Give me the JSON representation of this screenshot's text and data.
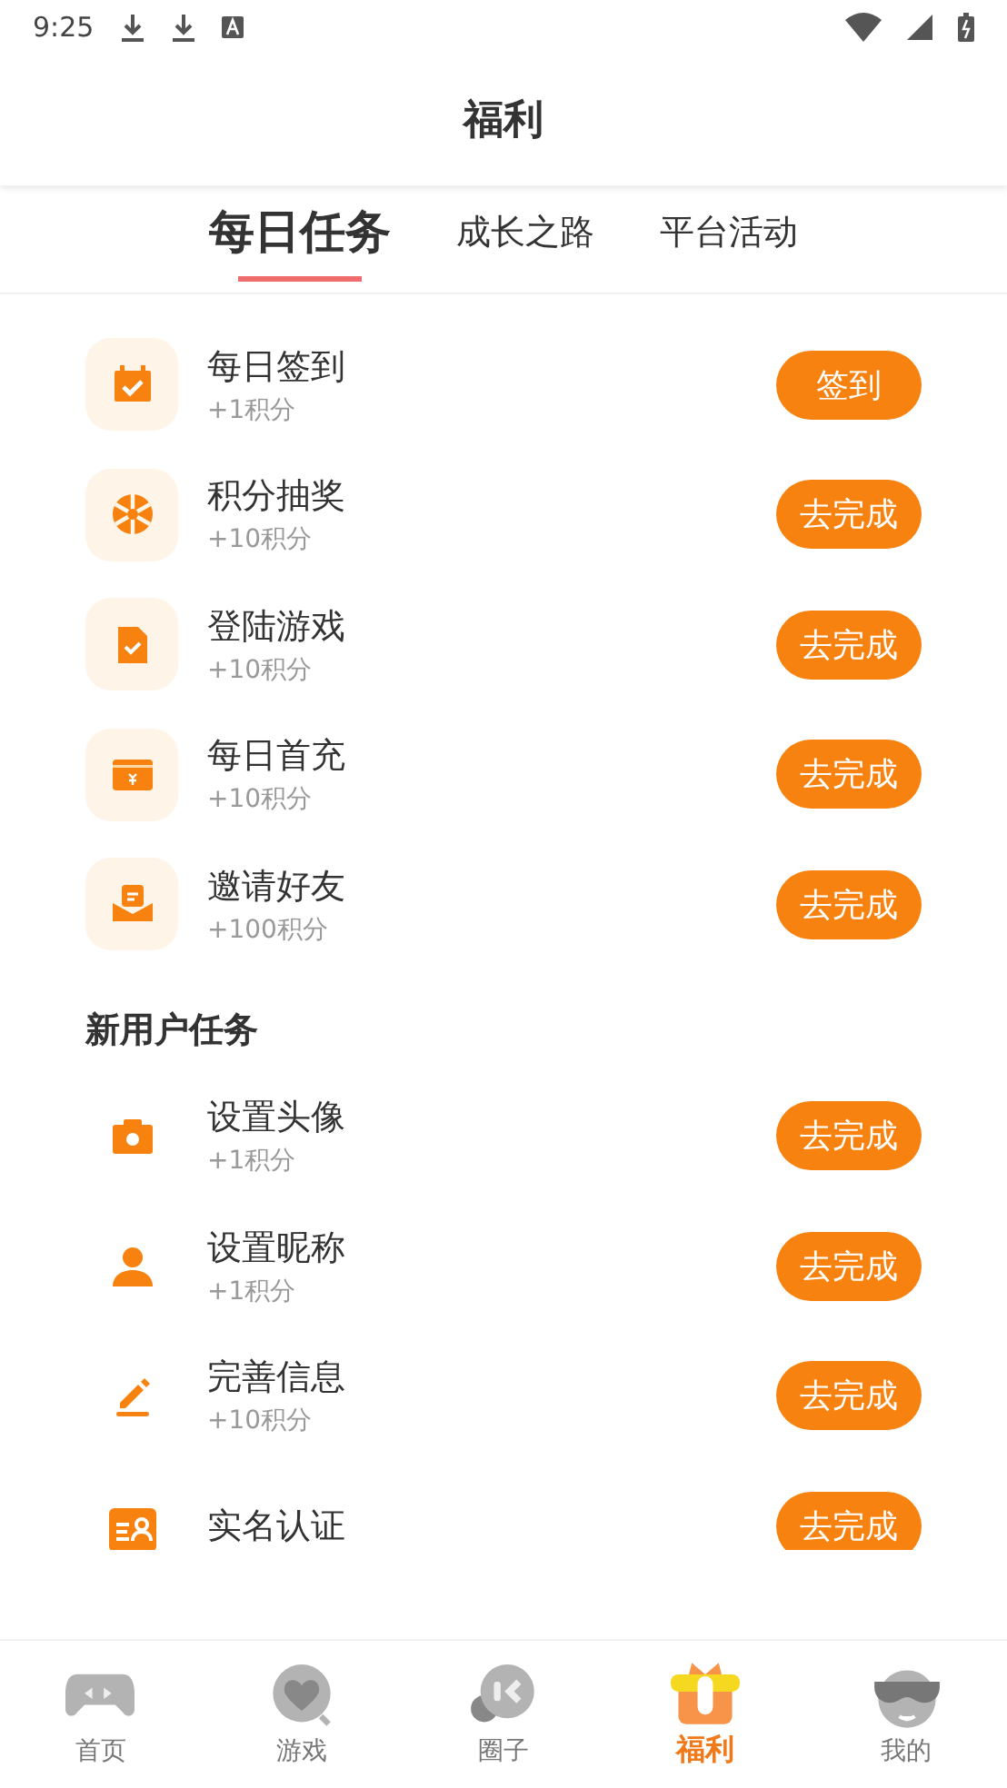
{
  "status_bar": {
    "time": "9:25"
  },
  "header": {
    "title": "福利"
  },
  "tabs": [
    {
      "label": "每日任务",
      "selected": true
    },
    {
      "label": "成长之路",
      "selected": false
    },
    {
      "label": "平台活动",
      "selected": false
    }
  ],
  "daily_tasks": [
    {
      "kind": "calendar",
      "title": "每日签到",
      "reward": "+1积分",
      "button": "签到"
    },
    {
      "kind": "wheel",
      "title": "积分抽奖",
      "reward": "+10积分",
      "button": "去完成"
    },
    {
      "kind": "document",
      "title": "登陆游戏",
      "reward": "+10积分",
      "button": "去完成"
    },
    {
      "kind": "wallet",
      "title": "每日首充",
      "reward": "+10积分",
      "button": "去完成"
    },
    {
      "kind": "envelope",
      "title": "邀请好友",
      "reward": "+100积分",
      "button": "去完成"
    }
  ],
  "new_user_section": {
    "title": "新用户任务",
    "tasks": [
      {
        "kind": "camera",
        "title": "设置头像",
        "reward": "+1积分",
        "button": "去完成"
      },
      {
        "kind": "person",
        "title": "设置昵称",
        "reward": "+1积分",
        "button": "去完成"
      },
      {
        "kind": "pencil",
        "title": "完善信息",
        "reward": "+10积分",
        "button": "去完成"
      },
      {
        "kind": "idcard",
        "title": "实名认证",
        "button": "去完成"
      }
    ]
  },
  "bottom_nav": [
    {
      "kind": "gamepad",
      "label": "首页",
      "selected": false
    },
    {
      "kind": "heart",
      "label": "游戏",
      "selected": false
    },
    {
      "kind": "chat",
      "label": "圈子",
      "selected": false
    },
    {
      "kind": "gift",
      "label": "福利",
      "selected": true
    },
    {
      "kind": "face",
      "label": "我的",
      "selected": false
    }
  ]
}
